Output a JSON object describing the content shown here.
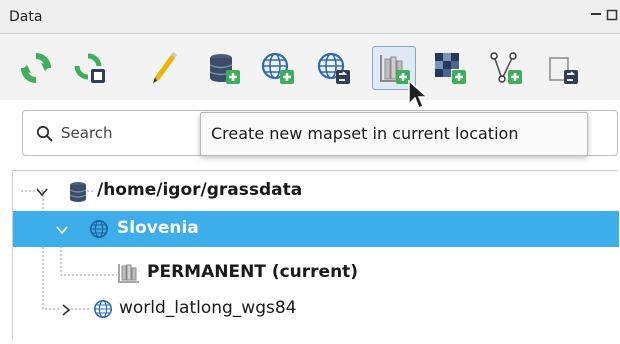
{
  "panel": {
    "title": "Data"
  },
  "toolbar": {
    "buttons": [
      {
        "name": "reload-tree",
        "icon": "reload-icon"
      },
      {
        "name": "reload-current-mapset",
        "icon": "reload-mapset-icon"
      },
      {
        "name": "edit",
        "icon": "pencil-icon"
      },
      {
        "name": "add-grass-database",
        "icon": "database-add-icon"
      },
      {
        "name": "create-location",
        "icon": "location-add-icon"
      },
      {
        "name": "import-location",
        "icon": "location-import-icon"
      },
      {
        "name": "create-mapset",
        "icon": "mapset-add-icon",
        "active": true
      },
      {
        "name": "import-raster",
        "icon": "raster-add-icon"
      },
      {
        "name": "import-vector",
        "icon": "vector-add-icon"
      },
      {
        "name": "link-external",
        "icon": "link-import-icon"
      }
    ]
  },
  "search": {
    "placeholder": "Search"
  },
  "tooltip": {
    "text": "Create new mapset in current location"
  },
  "tree": {
    "database": {
      "label": "/home/igor/grassdata",
      "icon": "database-icon"
    },
    "locations": [
      {
        "label": "Slovenia",
        "icon": "globe-icon",
        "selected": true,
        "expanded": true,
        "mapsets": [
          {
            "label": "PERMANENT  (current)",
            "icon": "mapset-icon"
          }
        ]
      },
      {
        "label": "world_latlong_wgs84",
        "icon": "globe-icon",
        "selected": false,
        "expanded": false
      }
    ]
  },
  "colors": {
    "selection": "#3daee9",
    "accent_green": "#3fae5a",
    "icon_blue": "#2b6cb0",
    "database_navy": "#3a4d68"
  }
}
